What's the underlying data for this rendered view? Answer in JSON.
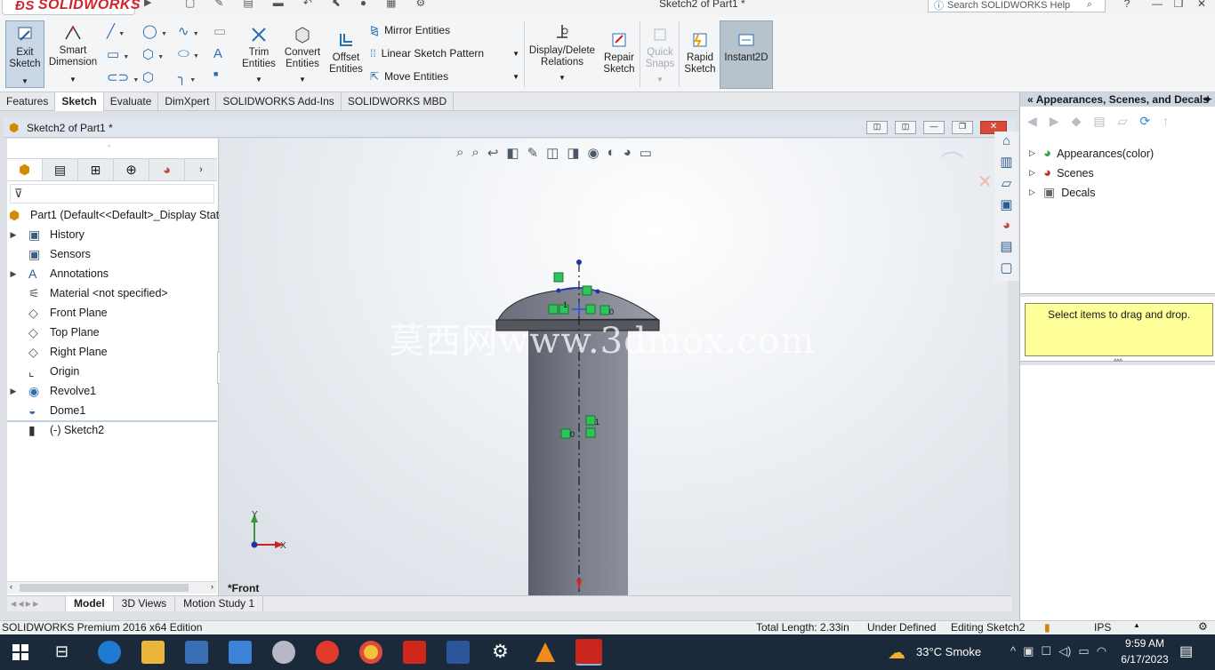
{
  "app": {
    "logo_text": "SOLIDWORKS",
    "window_title": "Sketch2 of Part1 *",
    "search_placeholder": "Search SOLIDWORKS Help"
  },
  "ribbon": {
    "exit_sketch": "Exit Sketch",
    "smart_dimension": "Smart Dimension",
    "trim_entities": "Trim Entities",
    "convert_entities": "Convert Entities",
    "offset_entities": "Offset Entities",
    "mirror_entities": "Mirror Entities",
    "linear_sketch_pattern": "Linear Sketch Pattern",
    "move_entities": "Move Entities",
    "display_delete_relations": "Display/Delete Relations",
    "repair_sketch": "Repair Sketch",
    "quick_snaps": "Quick Snaps",
    "rapid_sketch": "Rapid Sketch",
    "instant2d": "Instant2D"
  },
  "command_tabs": [
    "Features",
    "Sketch",
    "Evaluate",
    "DimXpert",
    "SOLIDWORKS Add-Ins",
    "SOLIDWORKS MBD"
  ],
  "document": {
    "title": "Sketch2 of Part1 *",
    "view_label": "*Front",
    "watermark": "莫西网www.3dmox.com"
  },
  "feature_tree": {
    "root": "Part1  (Default<<Default>_Display State",
    "items": [
      {
        "label": "History",
        "expandable": true
      },
      {
        "label": "Sensors",
        "expandable": false
      },
      {
        "label": "Annotations",
        "expandable": true
      },
      {
        "label": "Material <not specified>",
        "expandable": false
      },
      {
        "label": "Front Plane",
        "expandable": false
      },
      {
        "label": "Top Plane",
        "expandable": false
      },
      {
        "label": "Right Plane",
        "expandable": false
      },
      {
        "label": "Origin",
        "expandable": false
      },
      {
        "label": "Revolve1",
        "expandable": true
      },
      {
        "label": "Dome1",
        "expandable": false
      },
      {
        "label": "(-) Sketch2",
        "expandable": false
      }
    ]
  },
  "model_tabs": [
    "Model",
    "3D Views",
    "Motion Study 1"
  ],
  "task_pane": {
    "title": "Appearances, Scenes, and Decals",
    "items": [
      "Appearances(color)",
      "Scenes",
      "Decals"
    ],
    "drag_note": "Select items to drag and drop."
  },
  "status_bar": {
    "product": "SOLIDWORKS Premium 2016 x64 Edition",
    "total_length": "Total Length: 2.33in",
    "definition": "Under Defined",
    "editing": "Editing Sketch2",
    "units": "IPS"
  },
  "taskbar": {
    "weather": "33°C  Smoke",
    "time": "9:59 AM",
    "date": "6/17/2023"
  },
  "triad": {
    "x_label": "X",
    "y_label": "Y"
  }
}
